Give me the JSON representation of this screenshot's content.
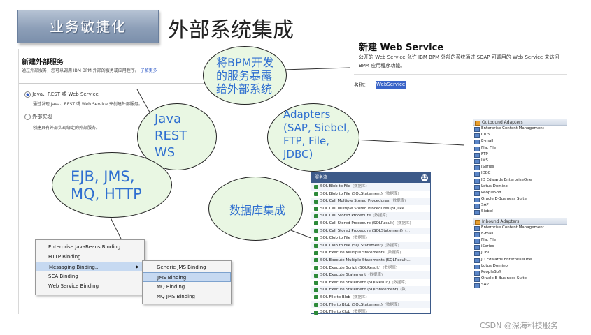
{
  "header": {
    "banner": "业务敏捷化",
    "title": "外部系统集成"
  },
  "left": {
    "section_title": "新建外部服务",
    "section_desc": "通过外部服务，您可以调用 IBM BPM 外部的服务或应用程序。",
    "learn_more": "了解更多",
    "option1_label": "Java、REST 或 Web Service",
    "option1_desc": "通过发现 Java、REST 或 Web Service 来创建外部服务。",
    "option2_label": "外部实现",
    "option2_desc": "创建具有外部实现绑定的外部服务。"
  },
  "context_menu": {
    "items": [
      "Enterprise JavaBeans Binding",
      "HTTP Binding",
      "Messaging Binding...",
      "SCA Binding",
      "Web Service Binding"
    ],
    "submenu": [
      "Generic JMS Binding",
      "JMS Binding",
      "MQ Binding",
      "MQ JMS Binding"
    ]
  },
  "bubbles": {
    "expose": "将BPM开发的服务暴露给外部系统",
    "java_rest_ws": "Java REST WS",
    "adapters": "Adapters (SAP, Siebel, FTP, File, JDBC)",
    "ejb": "EJB, JMS, MQ, HTTP",
    "db": "数据库集成"
  },
  "web_service": {
    "title": "新建 Web Service",
    "desc": "公开的 Web Service 允许 IBM BPM 外部的系统通过 SOAP 可调用的 Web Service 来访问 BPM 应用程序功能。",
    "name_label": "名称：",
    "name_value": "WebService"
  },
  "adapters": {
    "outbound_header": "Outbound Adapters",
    "outbound": [
      "Enterprise Content Management",
      "CICS",
      "E-mail",
      "Flat File",
      "FTP",
      "IMS",
      "iSeries",
      "JDBC",
      "JD Edwards EnterpriseOne",
      "Lotus Domino",
      "PeopleSoft",
      "Oracle E-Business Suite",
      "SAP",
      "Siebel"
    ],
    "inbound_header": "Inbound Adapters",
    "inbound": [
      "Enterprise Content Management",
      "E-mail",
      "Flat File",
      "iSeries",
      "JDBC",
      "JD Edwards EnterpriseOne",
      "Lotus Domino",
      "PeopleSoft",
      "Oracle E-Business Suite",
      "SAP"
    ]
  },
  "db_panel": {
    "title": "服务流",
    "count": "19",
    "items": [
      {
        "name": "SQL Blob to File",
        "note": "(数据库)"
      },
      {
        "name": "SQL Blob to File (SQLStatement)",
        "note": "(数据库)"
      },
      {
        "name": "SQL Call Multiple Stored Procedures",
        "note": "(数据库)"
      },
      {
        "name": "SQL Call Multiple Stored Procedures (SQLRe...",
        "note": ""
      },
      {
        "name": "SQL Call Stored Procedure",
        "note": "(数据库)"
      },
      {
        "name": "SQL Call Stored Procedure (SQLResult)",
        "note": "(数据库)"
      },
      {
        "name": "SQL Call Stored Procedure (SQLStatement)",
        "note": "(..."
      },
      {
        "name": "SQL Clob to File",
        "note": "(数据库)"
      },
      {
        "name": "SQL Clob to File (SQLStatement)",
        "note": "(数据库)"
      },
      {
        "name": "SQL Execute Multiple Statements",
        "note": "(数据库)"
      },
      {
        "name": "SQL Execute Multiple Statements (SQLResult...",
        "note": ""
      },
      {
        "name": "SQL Execute Script (SQLResult)",
        "note": "(数据库)"
      },
      {
        "name": "SQL Execute Statement",
        "note": "(数据库)"
      },
      {
        "name": "SQL Execute Statement (SQLResult)",
        "note": "(数据库)"
      },
      {
        "name": "SQL Execute Statement (SQLStatement)",
        "note": "(数..."
      },
      {
        "name": "SQL File to Blob",
        "note": "(数据库)"
      },
      {
        "name": "SQL File to Blob (SQLStatement)",
        "note": "(数据库)"
      },
      {
        "name": "SQL File to Clob",
        "note": "(数据库)"
      }
    ]
  },
  "watermark": "CSDN @深海科技服务"
}
